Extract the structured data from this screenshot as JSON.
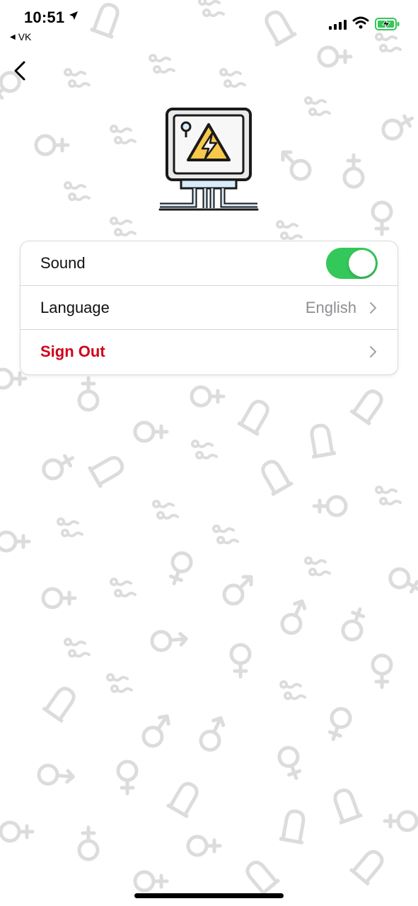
{
  "status_bar": {
    "time": "10:51",
    "back_app_label": "VK"
  },
  "nav": {
    "back_icon": "chevron-left-icon"
  },
  "hero": {
    "icon": "electrical-panel-warning-icon"
  },
  "settings": [
    {
      "label": "Sound",
      "control": "toggle",
      "on": true
    },
    {
      "label": "Language",
      "control": "disclosure",
      "value": "English"
    },
    {
      "label": "Sign Out",
      "control": "disclosure",
      "destructive": true
    }
  ],
  "colors": {
    "toggle_on": "#34c759",
    "destructive": "#d0021b",
    "secondary_text": "#8e8e93",
    "pattern": "#dcdcdc",
    "warning_yellow": "#f7c84a",
    "panel_blue": "#d6ecfb"
  }
}
